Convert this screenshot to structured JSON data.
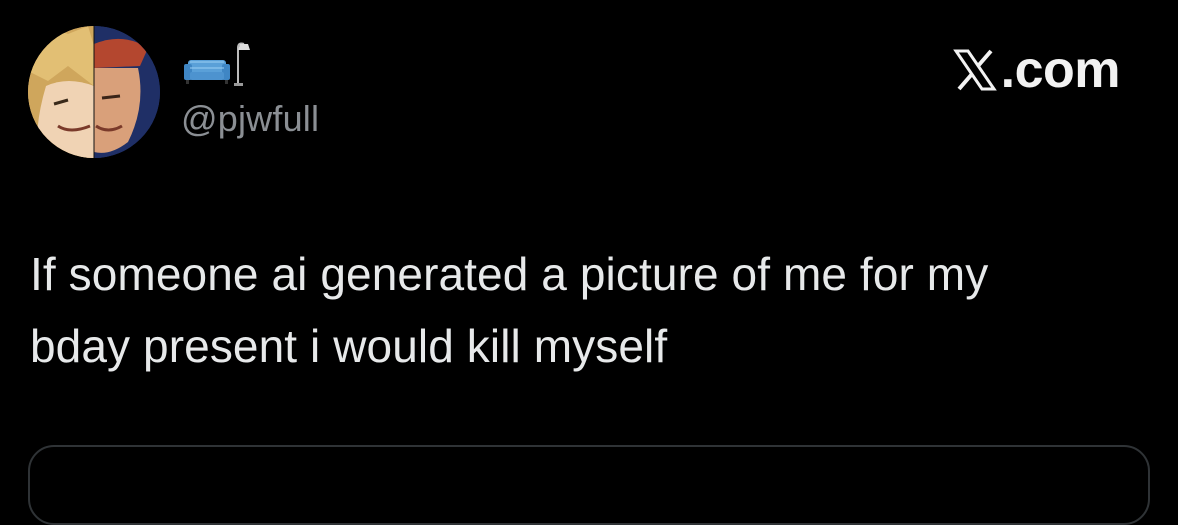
{
  "author": {
    "display_name_icon": "couch-and-lamp-icon",
    "handle": "@pjwfull"
  },
  "brand": {
    "label": ".com",
    "logo_icon": "x-logo-icon"
  },
  "tweet": {
    "lines": [
      "If someone ai generated a picture of me for my",
      "bday present i would kill myself"
    ]
  },
  "colors": {
    "background": "#000000",
    "text": "#e7e9ea",
    "secondary_text": "#8b8f94",
    "border": "#2f3336"
  }
}
